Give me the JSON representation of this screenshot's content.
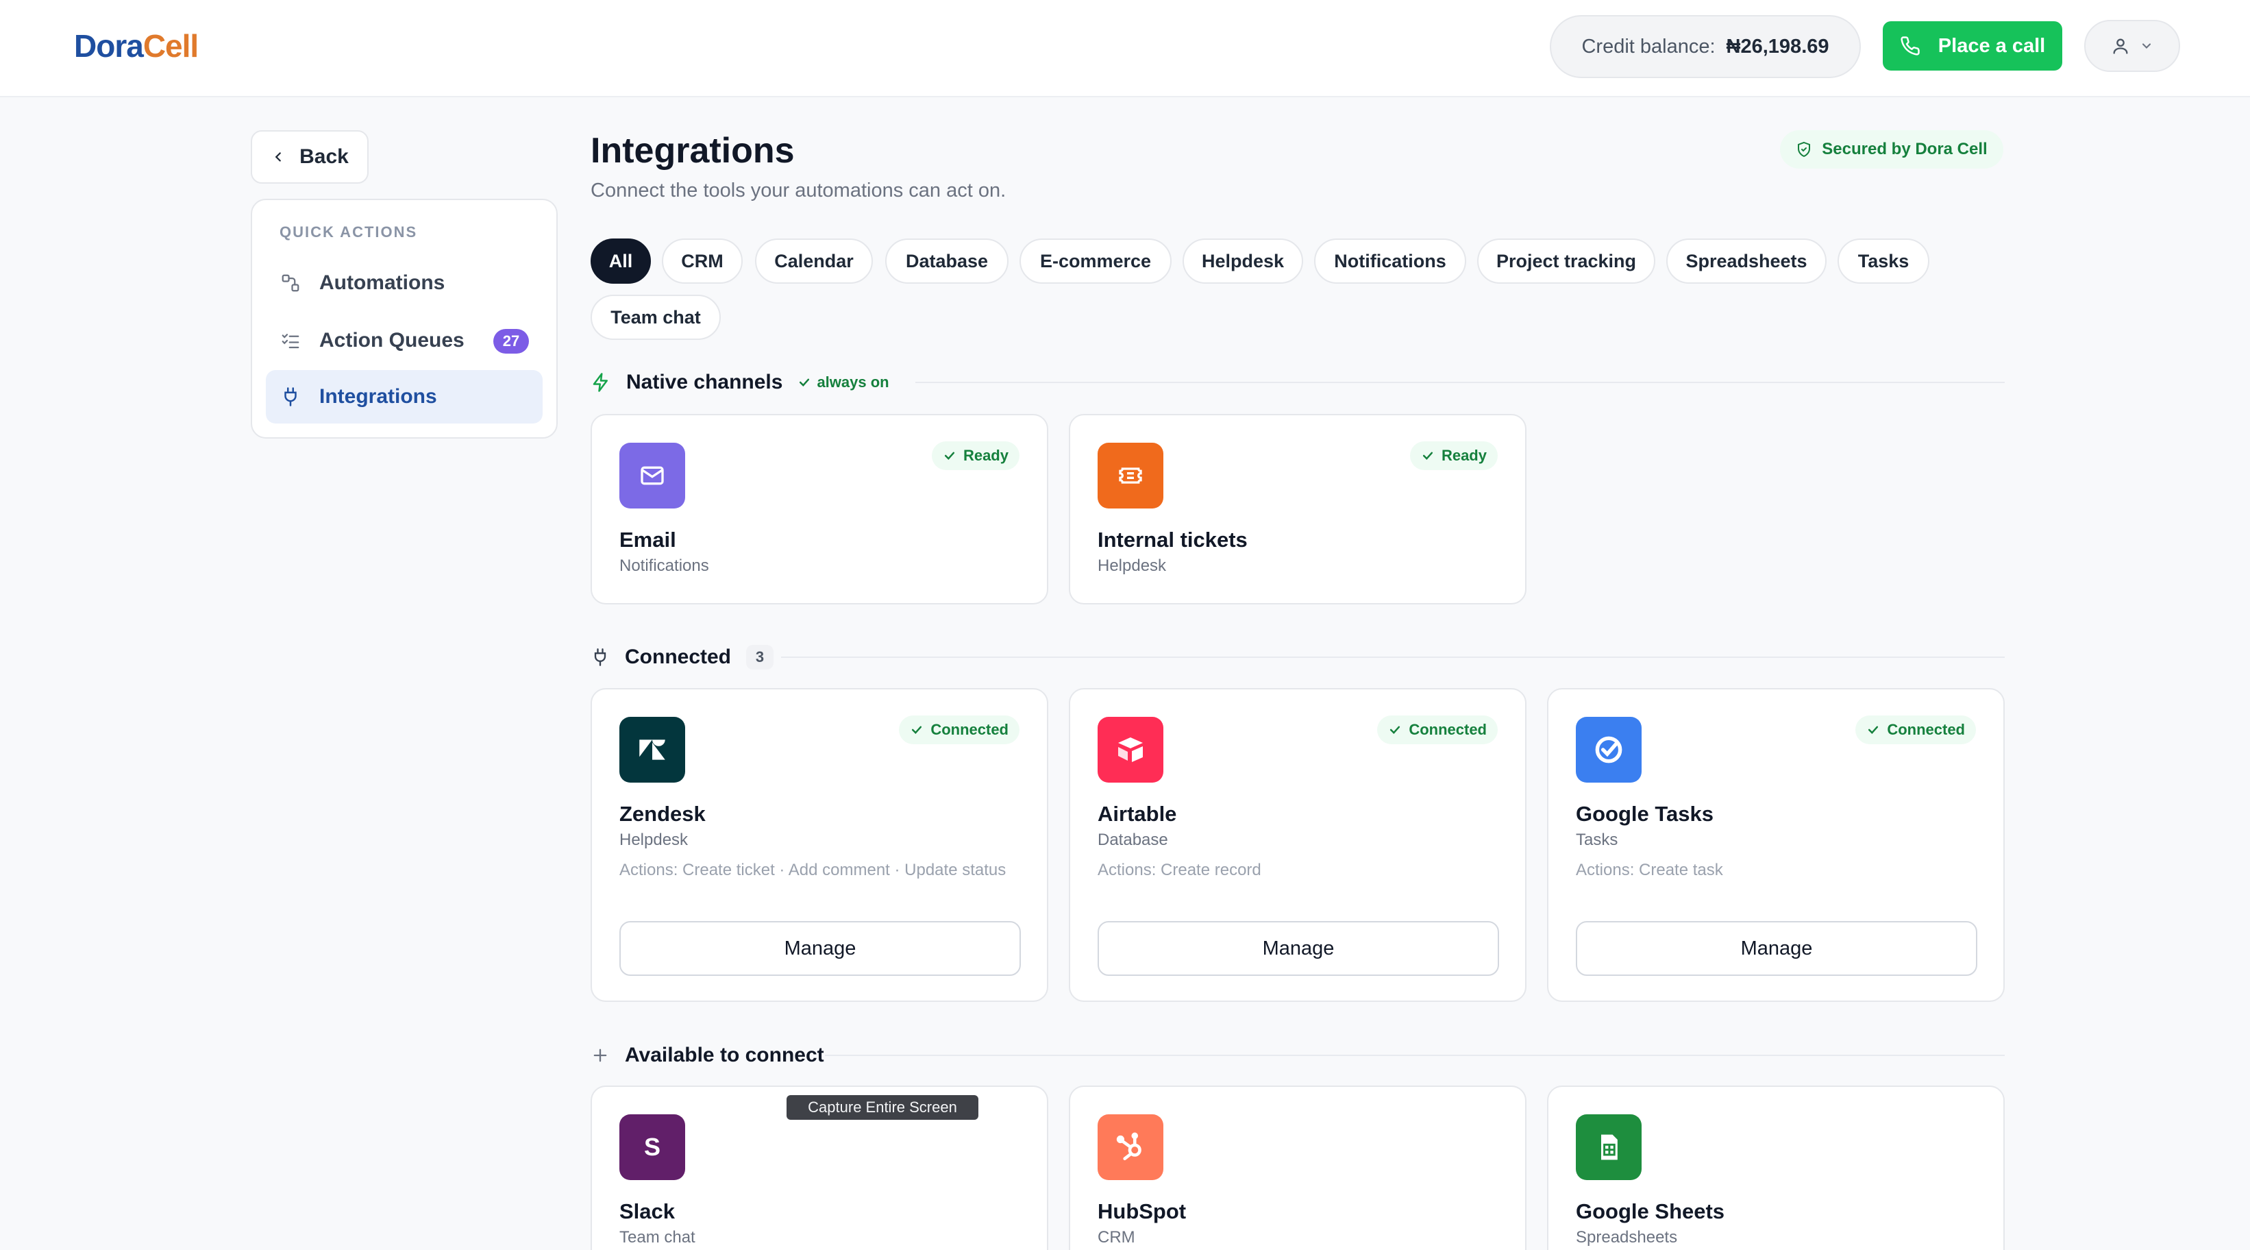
{
  "brand": {
    "part1": "Dora",
    "part2": "Cell"
  },
  "header": {
    "credit_label": "Credit balance:",
    "credit_amount": "₦26,198.69",
    "call_label": "Place a call"
  },
  "sidebar": {
    "back_label": "Back",
    "section_title": "QUICK ACTIONS",
    "items": [
      {
        "label": "Automations",
        "icon": "automations-icon"
      },
      {
        "label": "Action Queues",
        "icon": "checklist-icon",
        "badge": "27"
      },
      {
        "label": "Integrations",
        "icon": "plug-icon",
        "active": true
      }
    ]
  },
  "page": {
    "title": "Integrations",
    "subtitle": "Connect the tools your automations can act on.",
    "secured": "Secured by Dora Cell"
  },
  "filters": [
    "All",
    "CRM",
    "Calendar",
    "Database",
    "E-commerce",
    "Helpdesk",
    "Notifications",
    "Project tracking",
    "Spreadsheets",
    "Tasks",
    "Team chat"
  ],
  "sections": {
    "native": {
      "title": "Native channels",
      "pill": "always on"
    },
    "connected": {
      "title": "Connected",
      "count": "3"
    },
    "available": {
      "title": "Available to connect"
    }
  },
  "native_cards": [
    {
      "name": "Email",
      "category": "Notifications",
      "status": "Ready",
      "color": "#7c6ae6",
      "icon": "mail-icon"
    },
    {
      "name": "Internal tickets",
      "category": "Helpdesk",
      "status": "Ready",
      "color": "#f06a1c",
      "icon": "ticket-icon"
    }
  ],
  "connected_cards": [
    {
      "name": "Zendesk",
      "category": "Helpdesk",
      "status": "Connected",
      "actions": "Actions: Create ticket · Add comment · Update status",
      "manage": "Manage",
      "color": "#03363d",
      "icon": "zendesk-icon"
    },
    {
      "name": "Airtable",
      "category": "Database",
      "status": "Connected",
      "actions": "Actions: Create record",
      "manage": "Manage",
      "color": "#ff2d55",
      "icon": "airtable-icon"
    },
    {
      "name": "Google Tasks",
      "category": "Tasks",
      "status": "Connected",
      "actions": "Actions: Create task",
      "manage": "Manage",
      "color": "#3b7ff0",
      "icon": "google-tasks-icon"
    }
  ],
  "available_cards": [
    {
      "name": "Slack",
      "category": "Team chat",
      "color": "#611f69",
      "icon_letter": "S"
    },
    {
      "name": "HubSpot",
      "category": "CRM",
      "color": "#ff7a59",
      "icon": "hubspot-icon"
    },
    {
      "name": "Google Sheets",
      "category": "Spreadsheets",
      "color": "#1e8e3e",
      "icon": "sheets-icon"
    }
  ],
  "tooltip": "Capture Entire Screen"
}
